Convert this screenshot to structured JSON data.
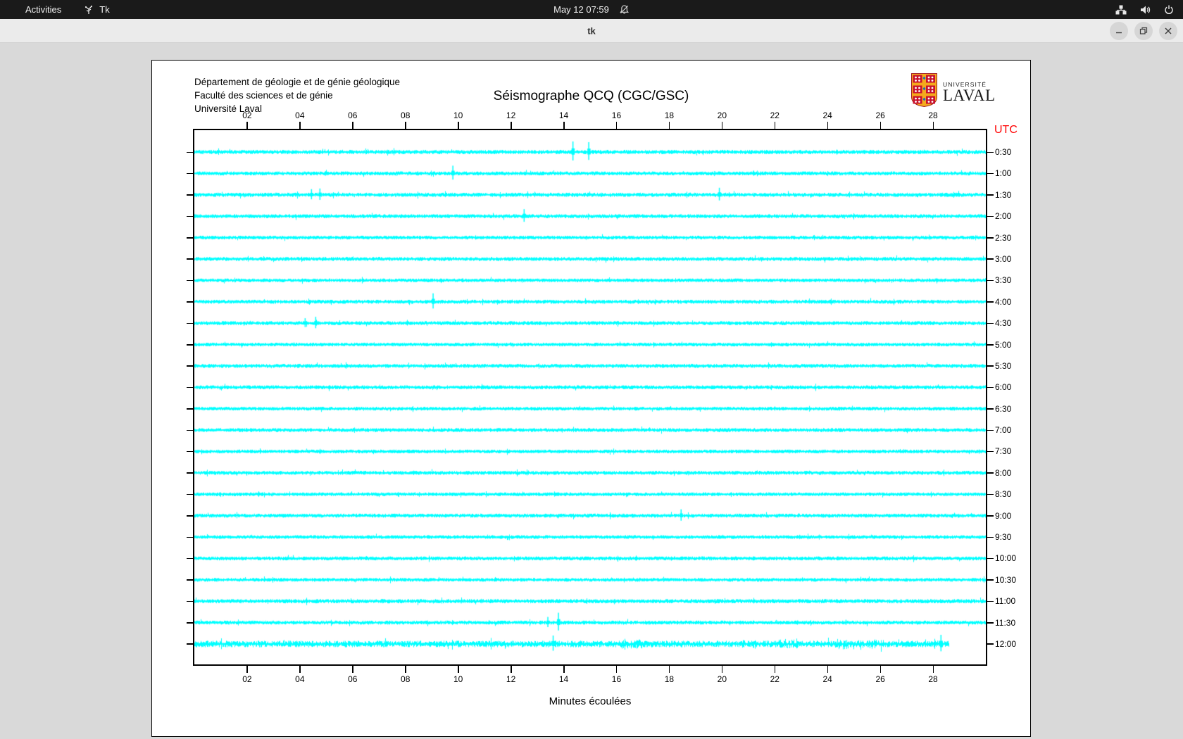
{
  "top_bar": {
    "activities": "Activities",
    "app_name": "Tk",
    "clock": "May 12 07:59"
  },
  "window": {
    "title": "tk"
  },
  "panel": {
    "institution_lines": [
      "Département de géologie et de génie géologique",
      "Faculté des sciences et de génie",
      "Université Laval"
    ],
    "logo": {
      "line1": "UNIVERSITÉ",
      "line2": "LAVAL"
    }
  },
  "chart_data": {
    "type": "line",
    "title": "Séismographe QCQ (CGC/GSC)",
    "xlabel": "Minutes écoulées",
    "right_axis_title": "UTC",
    "right_axis_title_color": "#ff0000",
    "trace_color": "#00ffff",
    "background": "#ffffff",
    "x_ticks": [
      "02",
      "04",
      "06",
      "08",
      "10",
      "12",
      "14",
      "16",
      "18",
      "20",
      "22",
      "24",
      "26",
      "28"
    ],
    "x_range_minutes": [
      0,
      30
    ],
    "row_duration_minutes": 30,
    "legend_position": "none",
    "grid": false,
    "rows": [
      {
        "label": "0:30",
        "noise": 1.3,
        "events": [
          {
            "type": "spike",
            "m": 14.35,
            "a": 15
          },
          {
            "type": "spike",
            "m": 14.95,
            "a": 14
          }
        ]
      },
      {
        "label": "1:00",
        "noise": 1.2,
        "events": [
          {
            "type": "spike",
            "m": 9.8,
            "a": 11
          },
          {
            "type": "spike",
            "m": 21.2,
            "a": 4
          }
        ]
      },
      {
        "label": "1:30",
        "noise": 1.3,
        "events": [
          {
            "type": "spike",
            "m": 4.44,
            "a": 8
          },
          {
            "type": "spike",
            "m": 4.76,
            "a": 9
          },
          {
            "type": "spike",
            "m": 19.9,
            "a": 10
          }
        ]
      },
      {
        "label": "2:00",
        "noise": 1.2,
        "events": [
          {
            "type": "spike",
            "m": 12.5,
            "a": 10
          }
        ]
      },
      {
        "label": "2:30",
        "noise": 1.1,
        "events": []
      },
      {
        "label": "3:00",
        "noise": 1.2,
        "events": []
      },
      {
        "label": "3:30",
        "noise": 1.1,
        "events": []
      },
      {
        "label": "4:00",
        "noise": 1.2,
        "events": [
          {
            "type": "spike",
            "m": 9.05,
            "a": 12
          }
        ]
      },
      {
        "label": "4:30",
        "noise": 1.2,
        "events": [
          {
            "type": "spike",
            "m": 4.2,
            "a": 7
          },
          {
            "type": "spike",
            "m": 4.6,
            "a": 9
          }
        ]
      },
      {
        "label": "5:00",
        "noise": 1.1,
        "events": []
      },
      {
        "label": "5:30",
        "noise": 1.2,
        "events": []
      },
      {
        "label": "6:00",
        "noise": 1.2,
        "events": []
      },
      {
        "label": "6:30",
        "noise": 1.1,
        "events": []
      },
      {
        "label": "7:00",
        "noise": 1.2,
        "events": []
      },
      {
        "label": "7:30",
        "noise": 1.1,
        "events": []
      },
      {
        "label": "8:00",
        "noise": 1.2,
        "events": []
      },
      {
        "label": "8:30",
        "noise": 1.1,
        "events": []
      },
      {
        "label": "9:00",
        "noise": 1.2,
        "events": [
          {
            "type": "spike",
            "m": 18.45,
            "a": 9
          }
        ]
      },
      {
        "label": "9:30",
        "noise": 1.1,
        "events": []
      },
      {
        "label": "10:00",
        "noise": 1.2,
        "events": []
      },
      {
        "label": "10:30",
        "noise": 1.1,
        "events": []
      },
      {
        "label": "11:00",
        "noise": 1.3,
        "events": []
      },
      {
        "label": "11:30",
        "noise": 1.2,
        "events": [
          {
            "type": "spike",
            "m": 13.4,
            "a": 8
          },
          {
            "type": "spike",
            "m": 13.8,
            "a": 14
          },
          {
            "type": "spike",
            "m": 24.7,
            "a": 4
          }
        ]
      },
      {
        "label": "12:00",
        "noise": 2.3,
        "end_minute": 28.6,
        "events": [
          {
            "type": "spike",
            "m": 13.6,
            "a": 12
          },
          {
            "type": "burst",
            "m": 16.6,
            "w": 0.9,
            "a": 4
          },
          {
            "type": "burst",
            "m": 21.0,
            "w": 0.6,
            "a": 3.5
          },
          {
            "type": "burst",
            "m": 22.5,
            "w": 0.7,
            "a": 4
          },
          {
            "type": "burst",
            "m": 24.6,
            "w": 0.8,
            "a": 4
          },
          {
            "type": "burst",
            "m": 25.7,
            "w": 0.9,
            "a": 4
          },
          {
            "type": "spike",
            "m": 28.3,
            "a": 13
          }
        ]
      }
    ]
  }
}
